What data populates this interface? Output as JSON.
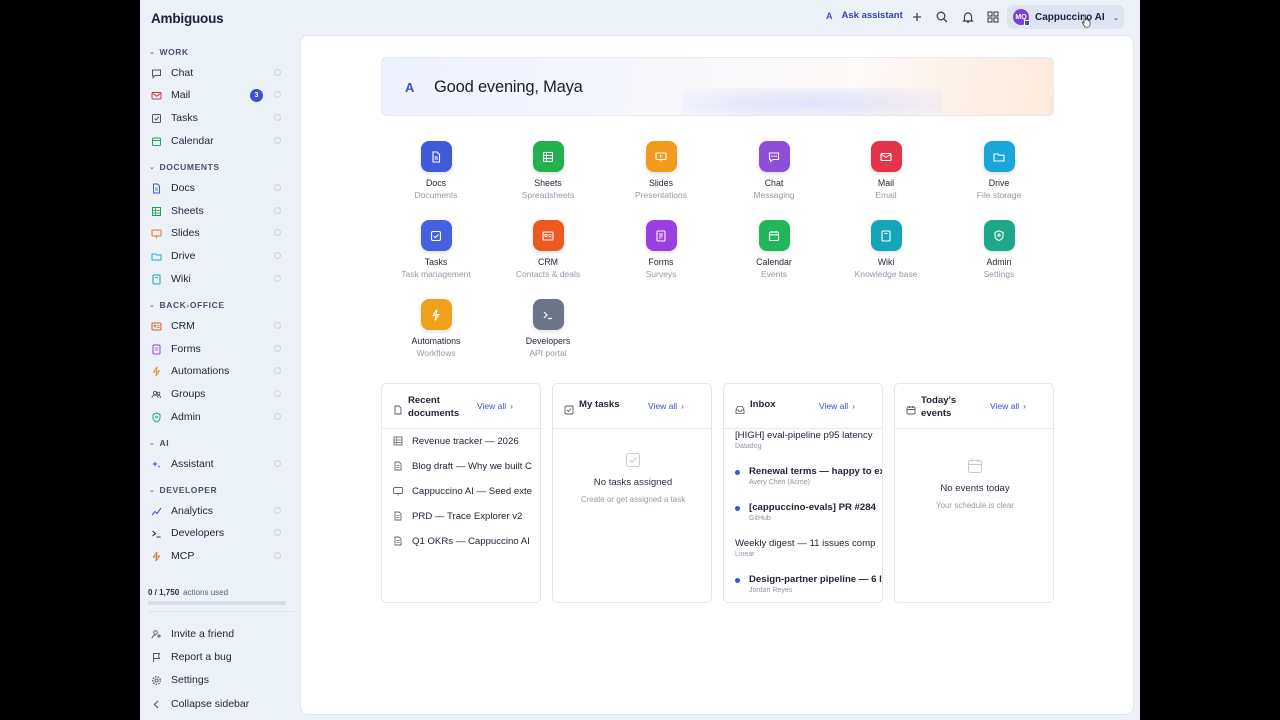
{
  "brand": {
    "name": "Ambiguous"
  },
  "topbar": {
    "ask_assistant": "Ask assistant",
    "ask_mark": "A",
    "account_initials": "MQ",
    "account_name": "Cappuccino AI"
  },
  "sidebar": {
    "sections": [
      {
        "title": "WORK",
        "items": [
          {
            "label": "Chat",
            "icon": "chat-icon"
          },
          {
            "label": "Mail",
            "icon": "mail-icon",
            "badge": "3"
          },
          {
            "label": "Tasks",
            "icon": "tasks-icon"
          },
          {
            "label": "Calendar",
            "icon": "calendar-icon"
          }
        ]
      },
      {
        "title": "DOCUMENTS",
        "items": [
          {
            "label": "Docs",
            "icon": "docs-icon"
          },
          {
            "label": "Sheets",
            "icon": "sheets-icon"
          },
          {
            "label": "Slides",
            "icon": "slides-icon"
          },
          {
            "label": "Drive",
            "icon": "drive-icon"
          },
          {
            "label": "Wiki",
            "icon": "wiki-icon"
          }
        ]
      },
      {
        "title": "BACK-OFFICE",
        "items": [
          {
            "label": "CRM",
            "icon": "crm-icon"
          },
          {
            "label": "Forms",
            "icon": "forms-icon"
          },
          {
            "label": "Automations",
            "icon": "automations-icon"
          },
          {
            "label": "Groups",
            "icon": "groups-icon"
          },
          {
            "label": "Admin",
            "icon": "admin-icon"
          }
        ]
      },
      {
        "title": "AI",
        "items": [
          {
            "label": "Assistant",
            "icon": "sparkle-icon"
          }
        ]
      },
      {
        "title": "DEVELOPER",
        "items": [
          {
            "label": "Analytics",
            "icon": "analytics-icon"
          },
          {
            "label": "Developers",
            "icon": "terminal-icon"
          },
          {
            "label": "MCP",
            "icon": "bolt-icon"
          }
        ]
      }
    ],
    "usage": {
      "count": "0 / 1,750",
      "label": "actions used",
      "fraction": 0
    },
    "footer": [
      {
        "label": "Invite a friend",
        "icon": "invite-icon"
      },
      {
        "label": "Report a bug",
        "icon": "flag-icon"
      },
      {
        "label": "Settings",
        "icon": "gear-icon"
      },
      {
        "label": "Collapse sidebar",
        "icon": "chevron-left-icon"
      }
    ]
  },
  "hero": {
    "greeting": "Good evening, Maya",
    "mark": "A"
  },
  "apps": [
    {
      "name": "Docs",
      "sub": "Documents",
      "color": "#3f5bd9"
    },
    {
      "name": "Sheets",
      "sub": "Spreadsheets",
      "color": "#22b14c"
    },
    {
      "name": "Slides",
      "sub": "Presentations",
      "color": "#f29a1e"
    },
    {
      "name": "Chat",
      "sub": "Messaging",
      "color": "#8e4fd8"
    },
    {
      "name": "Mail",
      "sub": "Email",
      "color": "#e2354a"
    },
    {
      "name": "Drive",
      "sub": "File storage",
      "color": "#18a7d6"
    },
    {
      "name": "Tasks",
      "sub": "Task management",
      "color": "#4361e0"
    },
    {
      "name": "CRM",
      "sub": "Contacts & deals",
      "color": "#ec5a1f"
    },
    {
      "name": "Forms",
      "sub": "Surveys",
      "color": "#9a3fe0"
    },
    {
      "name": "Calendar",
      "sub": "Events",
      "color": "#21b657"
    },
    {
      "name": "Wiki",
      "sub": "Knowledge base",
      "color": "#14a5b8"
    },
    {
      "name": "Admin",
      "sub": "Settings",
      "color": "#1ea88a"
    },
    {
      "name": "Automations",
      "sub": "Workflows",
      "color": "#f0a11c"
    },
    {
      "name": "Developers",
      "sub": "API portal",
      "color": "#6c7487"
    }
  ],
  "cards": {
    "recent": {
      "title": "Recent documents",
      "view_all": "View all",
      "docs": [
        {
          "title": "Revenue tracker — 2026",
          "icon": "sheet-icon"
        },
        {
          "title": "Blog draft — Why we built C",
          "icon": "doc-icon"
        },
        {
          "title": "Cappuccino AI — Seed exte",
          "icon": "slides-icon"
        },
        {
          "title": "PRD — Trace Explorer v2",
          "icon": "doc-icon"
        },
        {
          "title": "Q1 OKRs — Cappuccino AI",
          "icon": "doc-icon"
        }
      ]
    },
    "tasks": {
      "title": "My tasks",
      "view_all": "View all",
      "empty_title": "No tasks assigned",
      "empty_sub": "Create or get assigned a task"
    },
    "inbox": {
      "title": "Inbox",
      "view_all": "View all",
      "messages": [
        {
          "subject": "[HIGH] eval-pipeline p95 latency",
          "from": "Datadog",
          "unread": false
        },
        {
          "subject": "Renewal terms — happy to ex",
          "from": "Avery Chen (Acme)",
          "unread": true
        },
        {
          "subject": "[cappuccino-evals] PR #284",
          "from": "GitHub",
          "unread": true
        },
        {
          "subject": "Weekly digest — 11 issues comp",
          "from": "Linear",
          "unread": false
        },
        {
          "subject": "Design-partner pipeline — 6 l",
          "from": "Jordan Reyes",
          "unread": true
        }
      ]
    },
    "events": {
      "title": "Today's events",
      "view_all": "View all",
      "empty_title": "No events today",
      "empty_sub": "Your schedule is clear"
    }
  }
}
